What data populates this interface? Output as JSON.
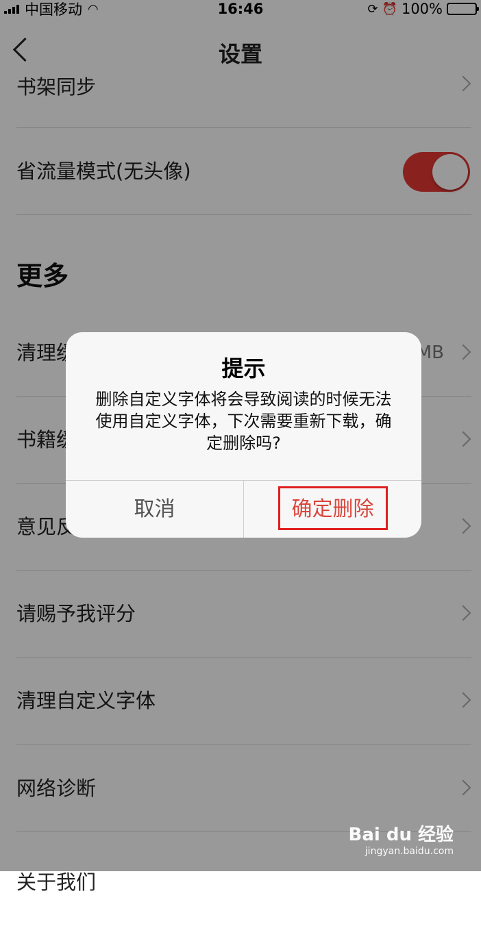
{
  "status": {
    "carrier": "中国移动",
    "time": "16:46",
    "battery": "100%",
    "signal_icon": "signal-icon",
    "wifi_icon": "wifi-icon",
    "battery_level": 1.0
  },
  "navbar": {
    "title": "设置"
  },
  "rows": {
    "shelf_sync": "书架同步",
    "data_saver": "省流量模式(无头像)",
    "clear_cache": "清理缓存",
    "clear_cache_value": "MB",
    "book_manage": "书籍缓存",
    "feedback": "意见反馈",
    "rate": "请赐予我评分",
    "clear_fonts": "清理自定义字体",
    "network": "网络诊断",
    "about": "关于我们"
  },
  "section": {
    "more": "更多"
  },
  "toggle": {
    "data_saver_on": true,
    "accent": "#e53935"
  },
  "dialog": {
    "title": "提示",
    "message": "删除自定义字体将会导致阅读的时候无法使用自定义字体，下次需要重新下载，确定删除吗?",
    "cancel": "取消",
    "confirm": "确定删除",
    "confirm_color": "#d9463d"
  },
  "watermark": {
    "main": "Bai du 经验",
    "sub": "jingyan.baidu.com"
  }
}
